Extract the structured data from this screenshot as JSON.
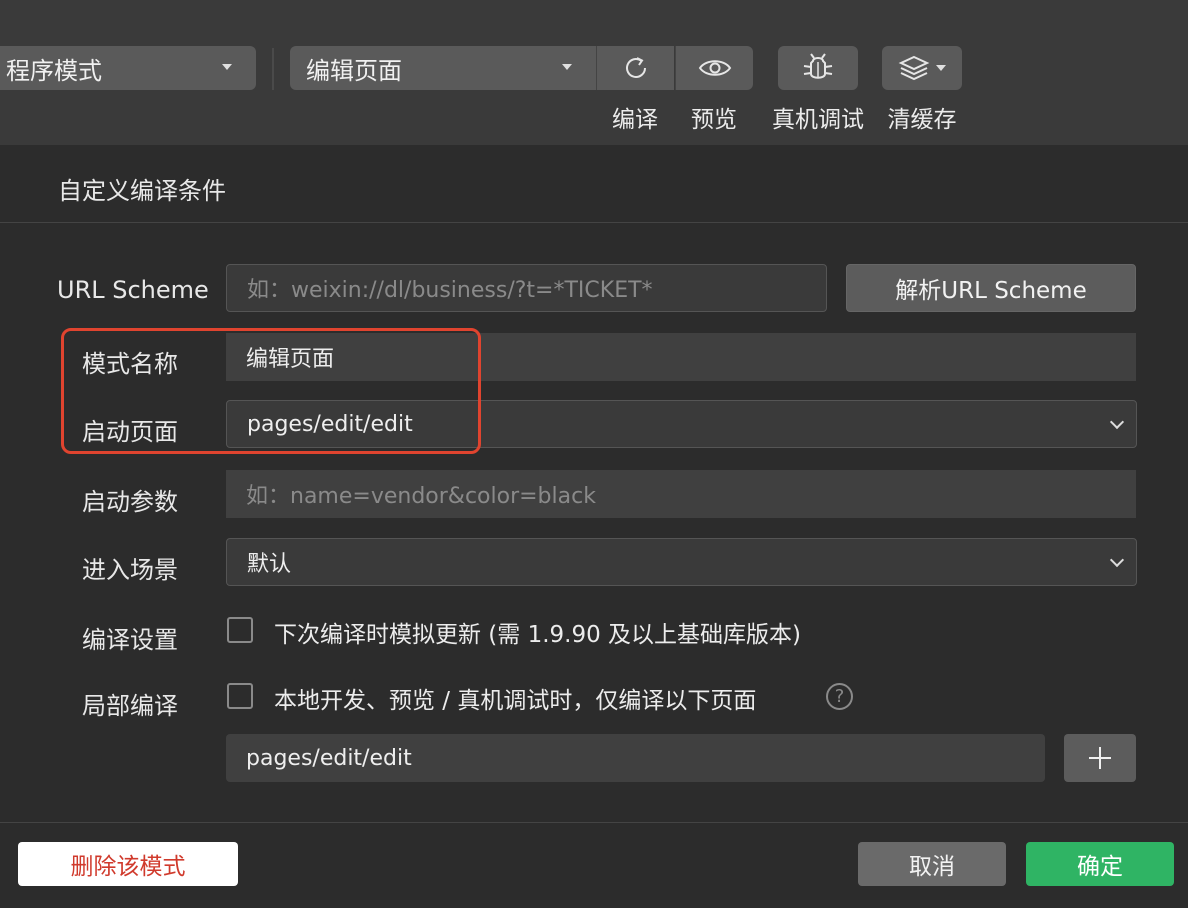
{
  "toolbar": {
    "mode_select": "程序模式",
    "page_select": "编辑页面",
    "compile_label": "编译",
    "preview_label": "预览",
    "debug_label": "真机调试",
    "cache_label": "清缓存"
  },
  "dialog": {
    "title": "自定义编译条件",
    "url_scheme": {
      "label": "URL Scheme",
      "placeholder": "如：weixin://dl/business/?t=*TICKET*",
      "parse_button": "解析URL Scheme"
    },
    "mode_name": {
      "label": "模式名称",
      "value": "编辑页面"
    },
    "start_page": {
      "label": "启动页面",
      "value": "pages/edit/edit"
    },
    "start_params": {
      "label": "启动参数",
      "placeholder": "如：name=vendor&color=black"
    },
    "scene": {
      "label": "进入场景",
      "value": "默认"
    },
    "compile_settings": {
      "label": "编译设置",
      "checkbox_text": "下次编译时模拟更新 (需 1.9.90 及以上基础库版本)",
      "checked": false
    },
    "partial_compile": {
      "label": "局部编译",
      "checkbox_text": "本地开发、预览 / 真机调试时，仅编译以下页面",
      "checked": false,
      "help_icon": "?",
      "page_value": "pages/edit/edit"
    }
  },
  "footer": {
    "delete_label": "删除该模式",
    "cancel_label": "取消",
    "confirm_label": "确定"
  },
  "colors": {
    "highlight_border": "#e0442f",
    "confirm_bg": "#2fb464",
    "delete_text": "#d03a2c"
  }
}
